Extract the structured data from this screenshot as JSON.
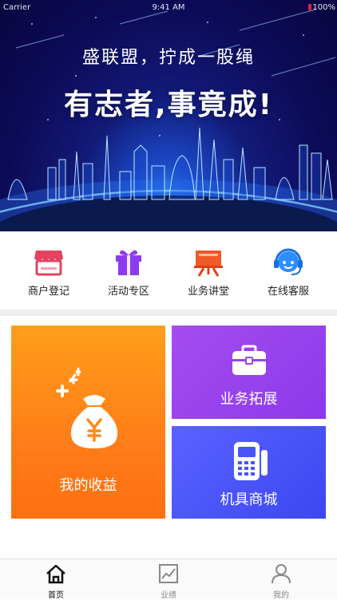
{
  "status_bar": {
    "left": "Carrier",
    "time": "9:41 AM",
    "battery": "100%"
  },
  "banner": {
    "subtitle": "盛联盟，拧成一股绳",
    "title": "有志者,事竟成!"
  },
  "quick_menu": [
    {
      "label": "商户登记",
      "icon": "store-icon"
    },
    {
      "label": "活动专区",
      "icon": "gift-icon"
    },
    {
      "label": "业务讲堂",
      "icon": "lecture-board-icon"
    },
    {
      "label": "在线客服",
      "icon": "headset-icon"
    }
  ],
  "tiles": {
    "earnings": {
      "label": "我的收益",
      "icon": "money-bag-icon",
      "color": "#ff8a1a"
    },
    "business": {
      "label": "业务拓展",
      "icon": "briefcase-icon",
      "color": "#9a45ee"
    },
    "shop": {
      "label": "机具商城",
      "icon": "pos-terminal-icon",
      "color": "#4a55f8"
    }
  },
  "tabbar": [
    {
      "label": "首页",
      "icon": "home-icon",
      "active": true
    },
    {
      "label": "业绩",
      "icon": "chart-icon",
      "active": false
    },
    {
      "label": "我的",
      "icon": "user-icon",
      "active": false
    }
  ],
  "colors": {
    "quick_store": "#e3435f",
    "quick_gift": "#8c3bf0",
    "quick_lecture": "#f05a28",
    "quick_headset": "#2f8cff"
  }
}
